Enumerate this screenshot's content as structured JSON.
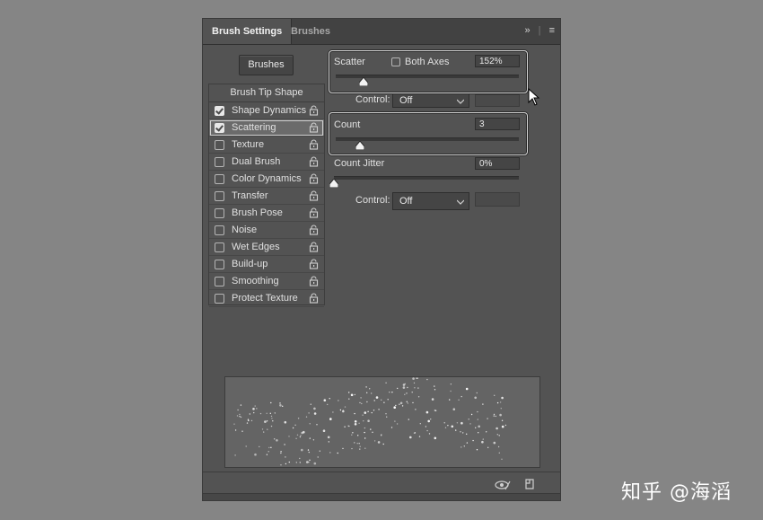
{
  "tabs": {
    "active": "Brush Settings",
    "inactive": "Brushes"
  },
  "toolbar": {
    "brushes_button": "Brushes"
  },
  "list": {
    "header": "Brush Tip Shape",
    "items": [
      {
        "label": "Shape Dynamics",
        "checked": true,
        "selected": false
      },
      {
        "label": "Scattering",
        "checked": true,
        "selected": true
      },
      {
        "label": "Texture",
        "checked": false,
        "selected": false
      },
      {
        "label": "Dual Brush",
        "checked": false,
        "selected": false
      },
      {
        "label": "Color Dynamics",
        "checked": false,
        "selected": false
      },
      {
        "label": "Transfer",
        "checked": false,
        "selected": false
      },
      {
        "label": "Brush Pose",
        "checked": false,
        "selected": false
      },
      {
        "label": "Noise",
        "checked": false,
        "selected": false
      },
      {
        "label": "Wet Edges",
        "checked": false,
        "selected": false
      },
      {
        "label": "Build-up",
        "checked": false,
        "selected": false
      },
      {
        "label": "Smoothing",
        "checked": false,
        "selected": false
      },
      {
        "label": "Protect Texture",
        "checked": false,
        "selected": false
      }
    ]
  },
  "scatter": {
    "label": "Scatter",
    "both_axes_label": "Both Axes",
    "both_axes_checked": false,
    "value": "152%",
    "slider_fraction": 0.15
  },
  "control1": {
    "label": "Control:",
    "value": "Off"
  },
  "count": {
    "label": "Count",
    "value": "3",
    "slider_fraction": 0.13
  },
  "count_jitter": {
    "label": "Count Jitter",
    "value": "0%",
    "slider_fraction": 0.0
  },
  "control2": {
    "label": "Control:",
    "value": "Off"
  },
  "watermark": "知乎 @海滔"
}
